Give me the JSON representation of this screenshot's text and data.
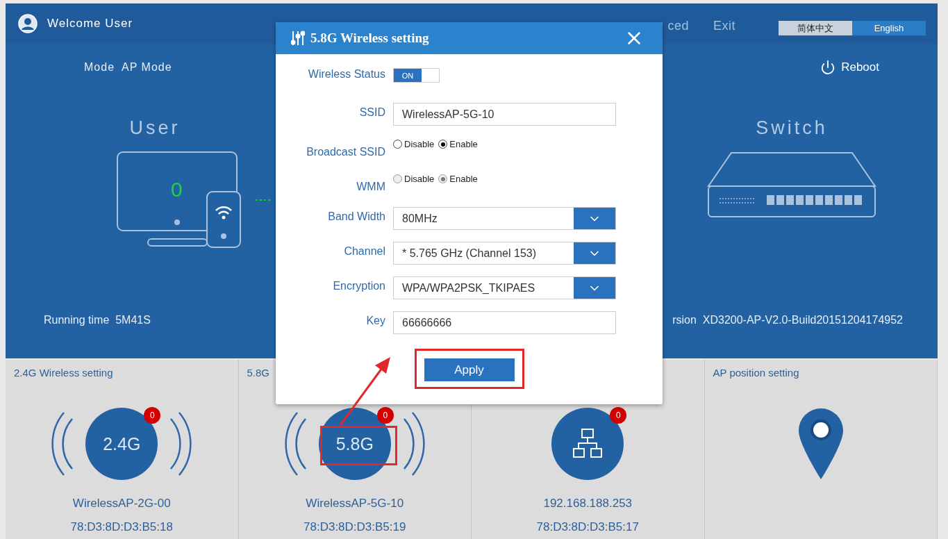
{
  "header": {
    "welcome": "Welcome User",
    "nav": [
      {
        "label": "ced"
      },
      {
        "label": "Exit"
      }
    ],
    "languages": [
      {
        "label": "简体中文",
        "selected": false
      },
      {
        "label": "English",
        "selected": true
      }
    ]
  },
  "status": {
    "mode_label": "Mode",
    "mode_value": "AP Mode",
    "reboot": "Reboot",
    "user_title": "User",
    "user_count": "0",
    "switch_title": "Switch",
    "running_label": "Running time",
    "running_value": "5M41S",
    "version_label": "rsion",
    "version_value": "XD3200-AP-V2.0-Build20151204174952"
  },
  "cards": [
    {
      "kind": "band",
      "title": "2.4G Wireless setting",
      "badge": "0",
      "label": "2.4G",
      "line1": "WirelessAP-2G-00",
      "line2": "78:D3:8D:D3:B5:18"
    },
    {
      "kind": "band",
      "title": "5.8G",
      "badge": "0",
      "label": "5.8G",
      "line1": "WirelessAP-5G-10",
      "line2": "78:D3:8D:D3:B5:19"
    },
    {
      "kind": "network",
      "badge": "0",
      "line1": "192.168.188.253",
      "line2": "78:D3:8D:D3:B5:17"
    },
    {
      "kind": "location",
      "title": "AP position setting"
    }
  ],
  "dialog": {
    "title": "5.8G Wireless setting",
    "apply": "Apply",
    "fields": [
      {
        "kind": "toggle",
        "label": "Wireless Status",
        "on": true,
        "text": "ON"
      },
      {
        "kind": "text",
        "label": "SSID",
        "value": "WirelessAP-5G-10"
      },
      {
        "kind": "radio",
        "label": "Broadcast SSID",
        "disabled": false,
        "options": [
          {
            "label": "Disable",
            "selected": false
          },
          {
            "label": "Enable",
            "selected": true
          }
        ]
      },
      {
        "kind": "radio",
        "label": "WMM",
        "disabled": true,
        "options": [
          {
            "label": "Disable",
            "selected": false
          },
          {
            "label": "Enable",
            "selected": true
          }
        ]
      },
      {
        "kind": "select",
        "label": "Band Width",
        "value": "80MHz"
      },
      {
        "kind": "select",
        "label": "Channel",
        "value": "* 5.765 GHz (Channel 153)"
      },
      {
        "kind": "select",
        "label": "Encryption",
        "value": "WPA/WPA2PSK_TKIPAES"
      },
      {
        "kind": "text",
        "label": "Key",
        "value": "66666666"
      }
    ]
  }
}
